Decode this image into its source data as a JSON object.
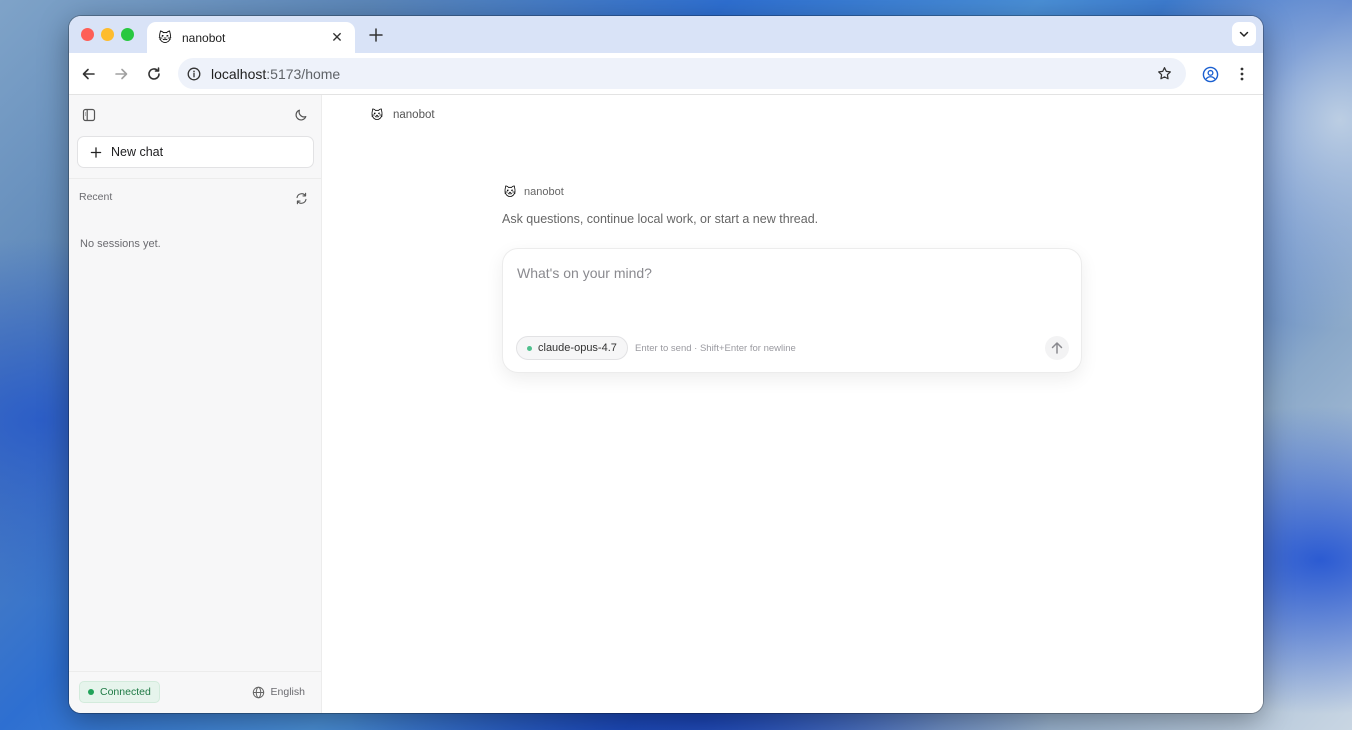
{
  "browser": {
    "tab": {
      "title": "nanobot",
      "favicon": "🐱"
    },
    "url_host": "localhost",
    "url_path": ":5173/home"
  },
  "sidebar": {
    "new_chat_label": "New chat",
    "recent_label": "Recent",
    "empty_text": "No sessions yet.",
    "status": "Connected",
    "language": "English"
  },
  "main": {
    "brand_emoji": "🐱",
    "header_name": "nanobot",
    "hero_name": "nanobot",
    "hero_subtitle": "Ask questions, continue local work, or start a new thread.",
    "composer": {
      "placeholder": "What's on your mind?",
      "model": "claude-opus-4.7",
      "hint": "Enter to send · Shift+Enter for newline"
    }
  },
  "colors": {
    "status_green": "#22a35a",
    "model_dot": "#4fc08d"
  }
}
